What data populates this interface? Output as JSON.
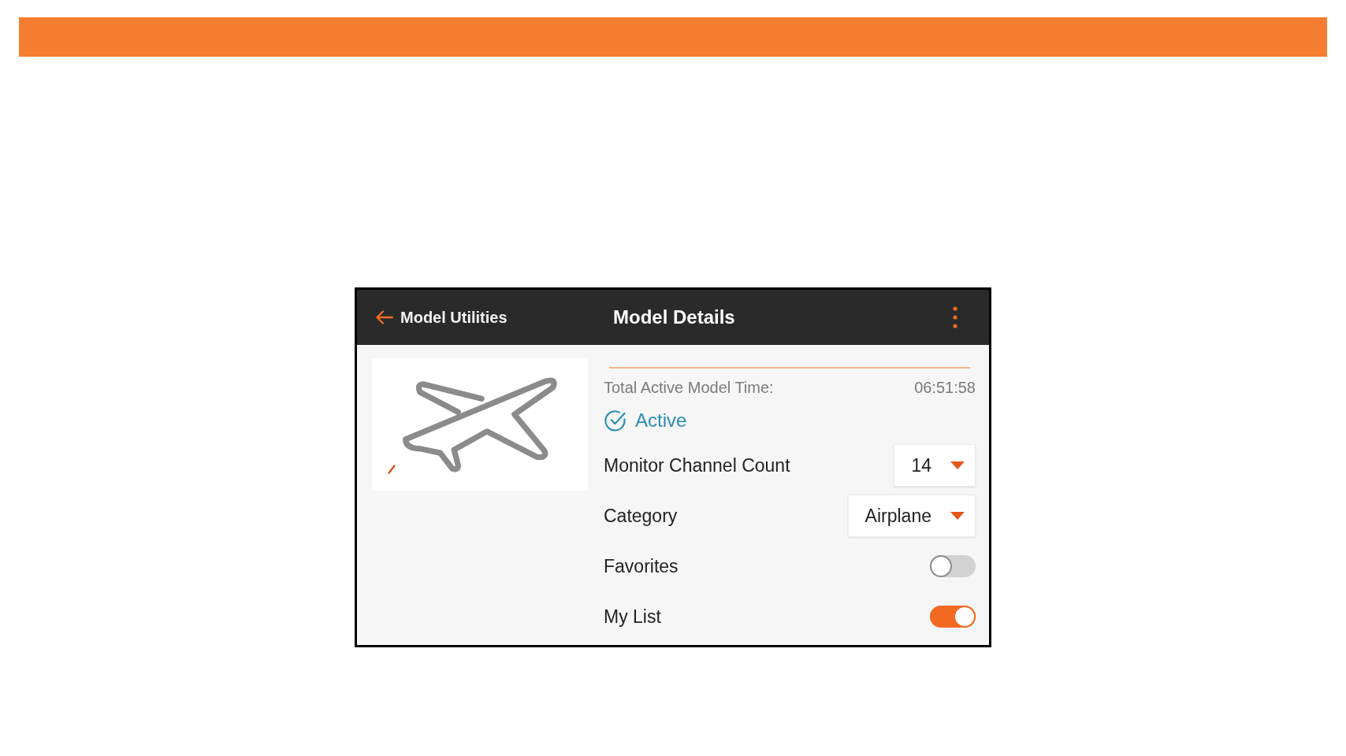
{
  "screen": {
    "header": {
      "back_label": "Model Utilities",
      "title": "Model Details"
    },
    "total_time": {
      "label": "Total Active Model Time:",
      "value": "06:51:58"
    },
    "status": {
      "label": "Active",
      "checked": true
    },
    "settings": [
      {
        "kind": "dropdown",
        "label": "Monitor Channel Count",
        "value": "14"
      },
      {
        "kind": "dropdown",
        "label": "Category",
        "value": "Airplane"
      },
      {
        "kind": "toggle",
        "label": "Favorites",
        "on": false
      },
      {
        "kind": "toggle",
        "label": "My List",
        "on": true
      }
    ]
  }
}
